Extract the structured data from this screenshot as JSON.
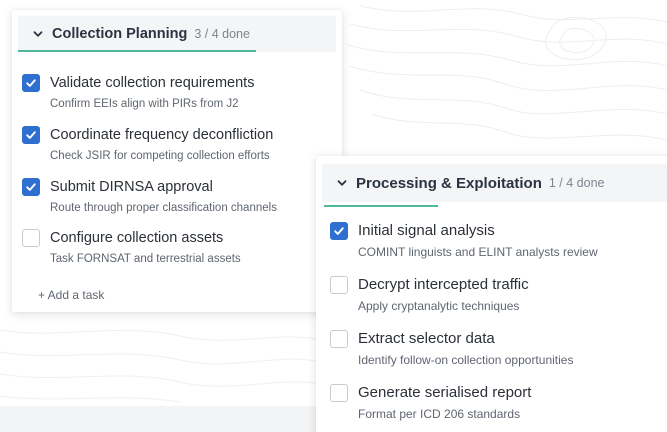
{
  "colors": {
    "accent": "#2f6fd0",
    "progress_underline": "#4fb89a",
    "background_strip": "#f3f4f6"
  },
  "left_panel": {
    "title": "Collection Planning",
    "count": "3 / 4 done",
    "chevron_icon": "chevron-down-icon",
    "tasks": [
      {
        "title": "Validate collection requirements",
        "subtitle": "Confirm EEIs align with PIRs from J2",
        "checked": true
      },
      {
        "title": "Coordinate frequency deconfliction",
        "subtitle": "Check JSIR for competing collection efforts",
        "checked": true
      },
      {
        "title": "Submit DIRNSA approval",
        "subtitle": "Route through proper classification channels",
        "checked": true
      },
      {
        "title": "Configure collection assets",
        "subtitle": "Task FORNSAT and terrestrial assets",
        "checked": false
      }
    ],
    "add_task_label": "+ Add a task"
  },
  "right_panel": {
    "title": "Processing & Exploitation",
    "count": "1 / 4 done",
    "chevron_icon": "chevron-down-icon",
    "tasks": [
      {
        "title": "Initial signal analysis",
        "subtitle": "COMINT linguists and ELINT analysts review",
        "checked": true
      },
      {
        "title": "Decrypt intercepted traffic",
        "subtitle": "Apply cryptanalytic techniques",
        "checked": false
      },
      {
        "title": "Extract selector data",
        "subtitle": "Identify follow-on collection opportunities",
        "checked": false
      },
      {
        "title": "Generate serialised report",
        "subtitle": "Format per ICD 206 standards",
        "checked": false
      }
    ]
  }
}
